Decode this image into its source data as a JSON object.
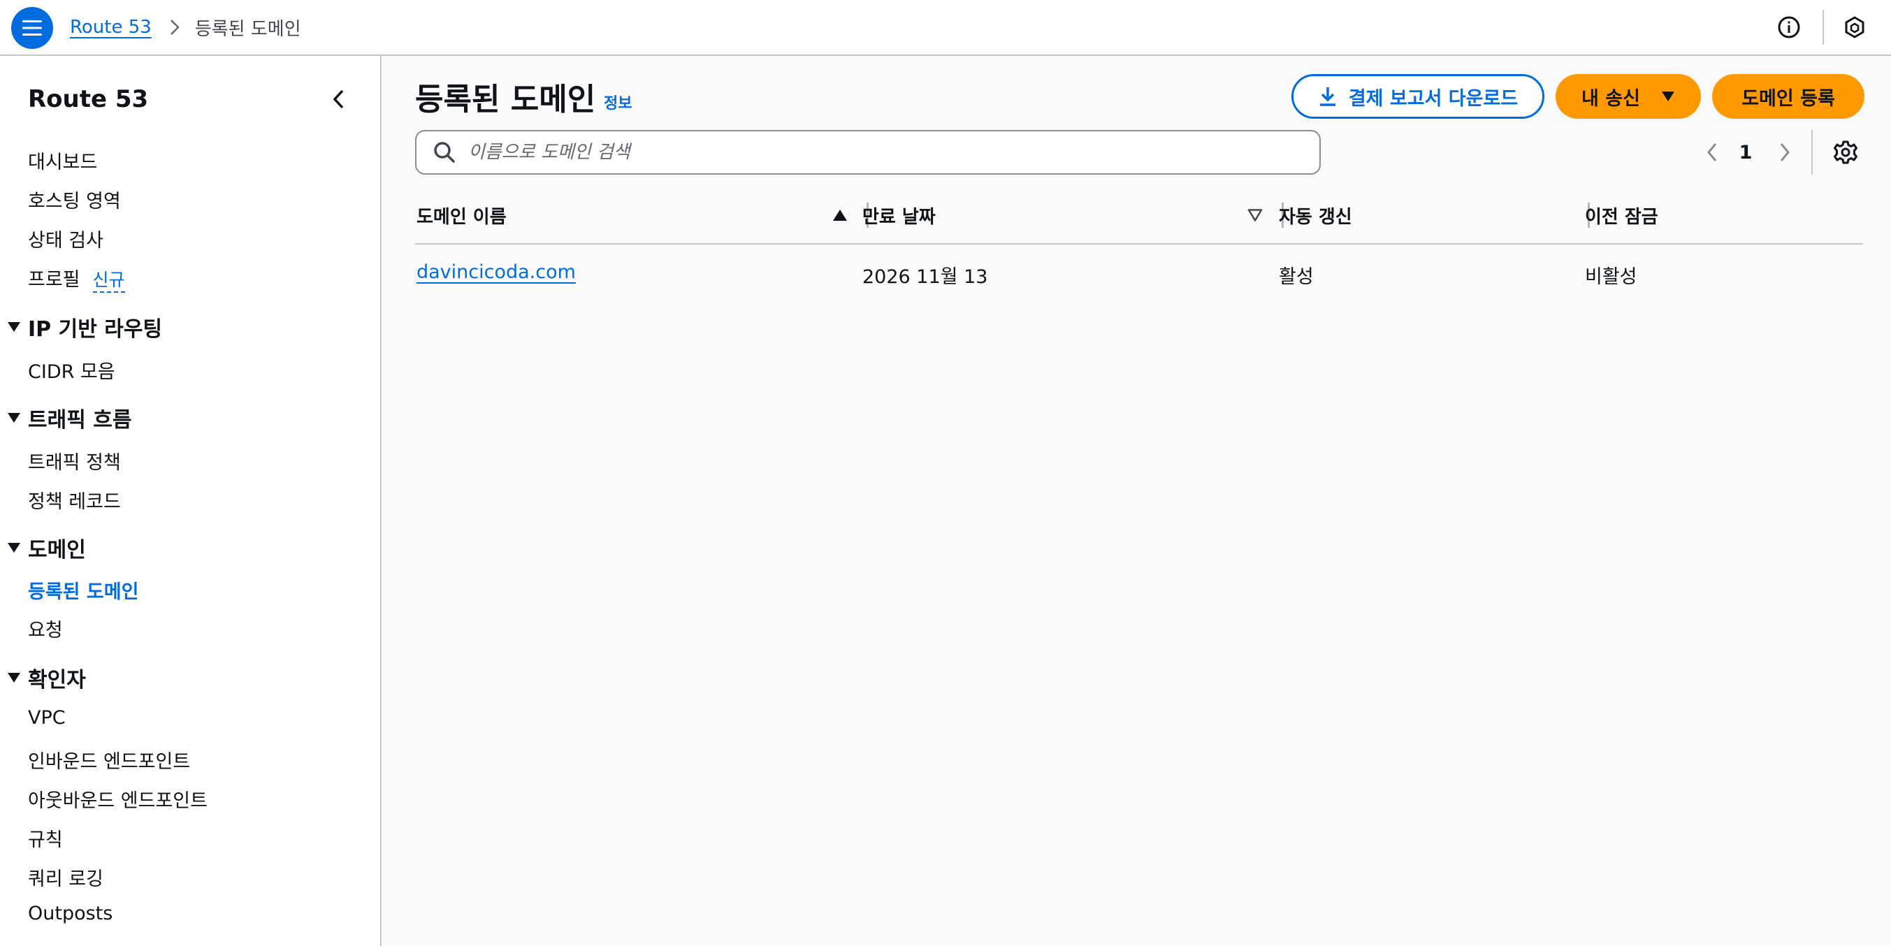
{
  "breadcrumb": {
    "root": "Route 53",
    "current": "등록된 도메인"
  },
  "icons": {
    "menu": "hamburger-menu-icon",
    "info": "info-circle-icon",
    "notifications": "hexagon-notification-icon",
    "settings": "gear-icon",
    "search": "search-icon"
  },
  "sidebar": {
    "title": "Route 53",
    "items": {
      "dashboard": "대시보드",
      "hosted_zones": "호스팅 영역",
      "health_checks": "상태 검사",
      "profiles": "프로필",
      "profiles_badge": "신규"
    },
    "sections": [
      {
        "title": "IP 기반 라우팅",
        "items": [
          "CIDR 모음"
        ]
      },
      {
        "title": "트래픽 흐름",
        "items": [
          "트래픽 정책",
          "정책 레코드"
        ]
      },
      {
        "title": "도메인",
        "items": [
          "등록된 도메인",
          "요청"
        ]
      },
      {
        "title": "확인자",
        "items": [
          "VPC",
          "인바운드 엔드포인트",
          "아웃바운드 엔드포인트",
          "규칙",
          "쿼리 로깅",
          "Outposts"
        ]
      }
    ]
  },
  "main": {
    "title": "등록된 도메인",
    "info_link": "정보",
    "buttons": {
      "download_report": "결제 보고서 다운로드",
      "my_transfers": "내 송신",
      "register_domain": "도메인 등록"
    },
    "search_placeholder": "이름으로 도메인 검색",
    "pagination": {
      "current_page": "1"
    },
    "table": {
      "headers": {
        "domain_name": "도메인 이름",
        "expiration": "만료 날짜",
        "auto_renew": "자동 갱신",
        "transfer_lock": "이전 잠금"
      },
      "rows": [
        {
          "domain_name": "davincicoda.com",
          "expiration": "2026 11월 13",
          "auto_renew": "활성",
          "transfer_lock": "비활성"
        }
      ]
    }
  },
  "colors": {
    "link": "#006ce0",
    "primary_button": "#ff9900",
    "border": "#c6c6cd"
  }
}
